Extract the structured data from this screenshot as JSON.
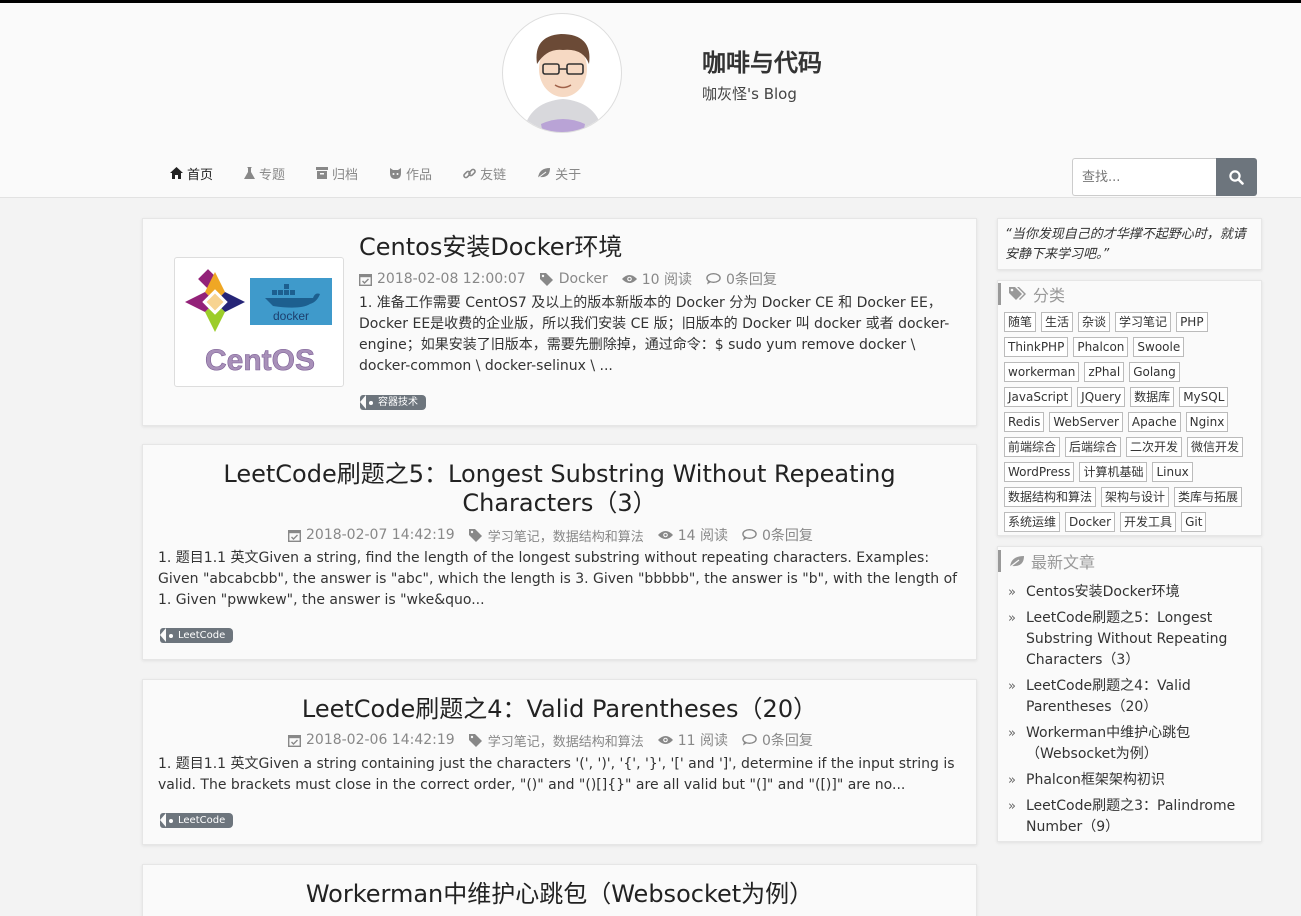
{
  "site": {
    "title": "咖啡与代码",
    "subtitle": "咖灰怪's Blog"
  },
  "nav": [
    {
      "label": "首页",
      "icon": "home-icon",
      "active": true
    },
    {
      "label": "专题",
      "icon": "flask-icon",
      "active": false
    },
    {
      "label": "归档",
      "icon": "archive-icon",
      "active": false
    },
    {
      "label": "作品",
      "icon": "github-icon",
      "active": false
    },
    {
      "label": "友链",
      "icon": "link-icon",
      "active": false
    },
    {
      "label": "关于",
      "icon": "leaf-icon",
      "active": false
    }
  ],
  "search": {
    "placeholder": "查找..."
  },
  "posts": [
    {
      "title": "Centos安装Docker环境",
      "date": "2018-02-08 12:00:07",
      "category": "Docker",
      "views": "10 阅读",
      "comments": "0条回复",
      "excerpt": "1. 准备工作需要 CentOS7 及以上的版本新版本的 Docker 分为 Docker CE 和 Docker EE，Docker EE是收费的企业版，所以我们安装 CE 版；旧版本的 Docker 叫 docker 或者 docker-engine；如果安装了旧版本，需要先删除掉，通过命令：$ sudo yum remove docker \\ docker-common \\ docker-selinux \\ ...",
      "tag": "容器技术",
      "thumb_text": "CentOS",
      "thumb_badge": "docker"
    },
    {
      "title": "LeetCode刷题之5：Longest Substring Without Repeating Characters（3）",
      "date": "2018-02-07 14:42:19",
      "category": "学习笔记，数据结构和算法",
      "views": "14 阅读",
      "comments": "0条回复",
      "excerpt": "1. 题目1.1 英文Given a string, find the length of the longest substring without repeating characters. Examples: Given \"abcabcbb\", the answer is \"abc\", which the length is 3. Given \"bbbbb\", the answer is \"b\", with the length of 1. Given \"pwwkew\", the answer is \"wke&quo...",
      "tag": "LeetCode"
    },
    {
      "title": "LeetCode刷题之4：Valid Parentheses（20）",
      "date": "2018-02-06 14:42:19",
      "category": "学习笔记，数据结构和算法",
      "views": "11 阅读",
      "comments": "0条回复",
      "excerpt": "1. 题目1.1 英文Given a string containing just the characters '(', ')', '{', '}', '[' and ']', determine if the input string is valid. The brackets must close in the correct order, \"()\" and \"()[]{}\" are all valid but \"(]\" and \"([)]\" are no...",
      "tag": "LeetCode"
    },
    {
      "title": "Workerman中维护心跳包（Websocket为例）"
    }
  ],
  "sidebar": {
    "quote": "“当你发现自己的才华撑不起野心时，就请安静下来学习吧。”",
    "categories_title": "分类",
    "categories": [
      "随笔",
      "生活",
      "杂谈",
      "学习笔记",
      "PHP",
      "ThinkPHP",
      "Phalcon",
      "Swoole",
      "workerman",
      "zPhal",
      "Golang",
      "JavaScript",
      "JQuery",
      "数据库",
      "MySQL",
      "Redis",
      "WebServer",
      "Apache",
      "Nginx",
      "前端综合",
      "后端综合",
      "二次开发",
      "微信开发",
      "WordPress",
      "计算机基础",
      "Linux",
      "数据结构和算法",
      "架构与设计",
      "类库与拓展",
      "系统运维",
      "Docker",
      "开发工具",
      "Git"
    ],
    "recent_title": "最新文章",
    "recent": [
      "Centos安装Docker环境",
      "LeetCode刷题之5：Longest Substring Without Repeating Characters（3）",
      "LeetCode刷题之4：Valid Parentheses（20）",
      "Workerman中维护心跳包（Websocket为例）",
      "Phalcon框架架构初识",
      "LeetCode刷题之3：Palindrome Number（9）"
    ]
  },
  "colors": {
    "accent": "#6d757d",
    "text": "#333333",
    "muted": "#888888"
  }
}
